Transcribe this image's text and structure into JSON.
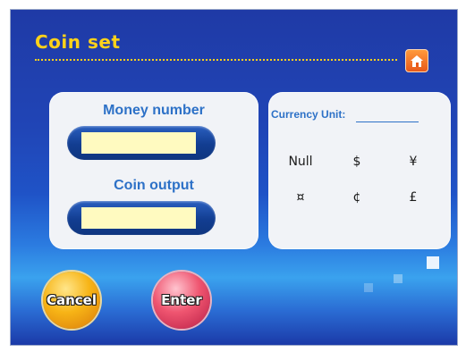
{
  "header": {
    "title": "Coin set"
  },
  "money_field": {
    "label": "Money number",
    "value": ""
  },
  "coin_field": {
    "label": "Coin output",
    "value": ""
  },
  "currency": {
    "label": "Currency Unit:",
    "options": [
      "Null",
      "$",
      "¥",
      "¤",
      "¢",
      "£"
    ]
  },
  "buttons": {
    "cancel": "Cancel",
    "enter": "Enter"
  },
  "colors": {
    "accent": "#ffd21a",
    "panel_label": "#2d71c7"
  },
  "icons": {
    "home": "home-icon"
  }
}
